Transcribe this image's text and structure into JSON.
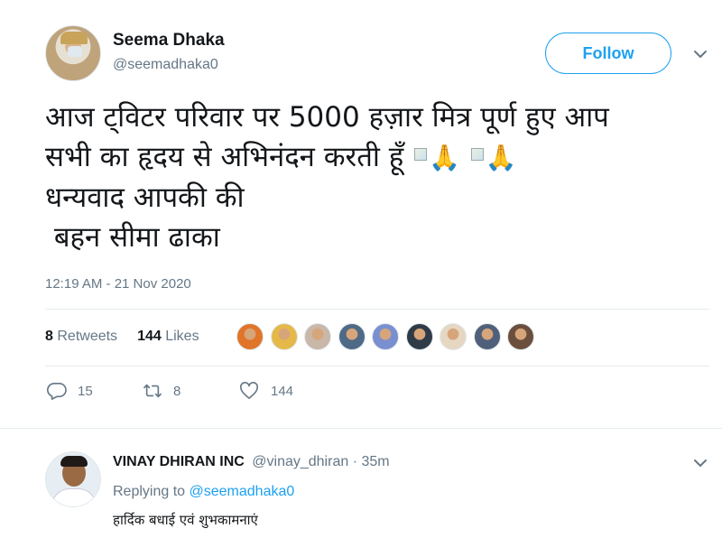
{
  "tweet": {
    "author": {
      "name": "Seema Dhaka",
      "handle": "@seemadhaka0"
    },
    "follow_label": "Follow",
    "text_lines": [
      "आज ट्विटर परिवार पर 5000 हज़ार मित्र पूर्ण हुए आप",
      "सभी का हृदय से अभिनंदन करती हूँ",
      "धन्यवाद आपकी की",
      " बहन सीमा ढाका"
    ],
    "emoji": "🙏",
    "timestamp": "12:19 AM - 21 Nov 2020",
    "stats": {
      "retweets_count": "8",
      "retweets_label": "Retweets",
      "likes_count": "144",
      "likes_label": "Likes"
    },
    "liker_colors": [
      "#e0752a",
      "#e5b949",
      "#c9b7a8",
      "#4f6a86",
      "#7a8fcf",
      "#2f3c48",
      "#e6d7c2",
      "#50607a",
      "#6b4f3e"
    ],
    "actions": {
      "reply_count": "15",
      "retweet_count": "8",
      "like_count": "144"
    }
  },
  "reply": {
    "author_name": "VINAY DHIRAN INC",
    "handle": "@vinay_dhiran",
    "separator": "·",
    "time": "35m",
    "replying_to_label": "Replying to",
    "replying_to_handle": "@seemadhaka0",
    "text": "हार्दिक बधाई एवं शुभकामनाएं"
  },
  "colors": {
    "accent": "#1da1f2",
    "muted": "#657786",
    "text": "#14171a",
    "divider": "#e6ecf0"
  }
}
